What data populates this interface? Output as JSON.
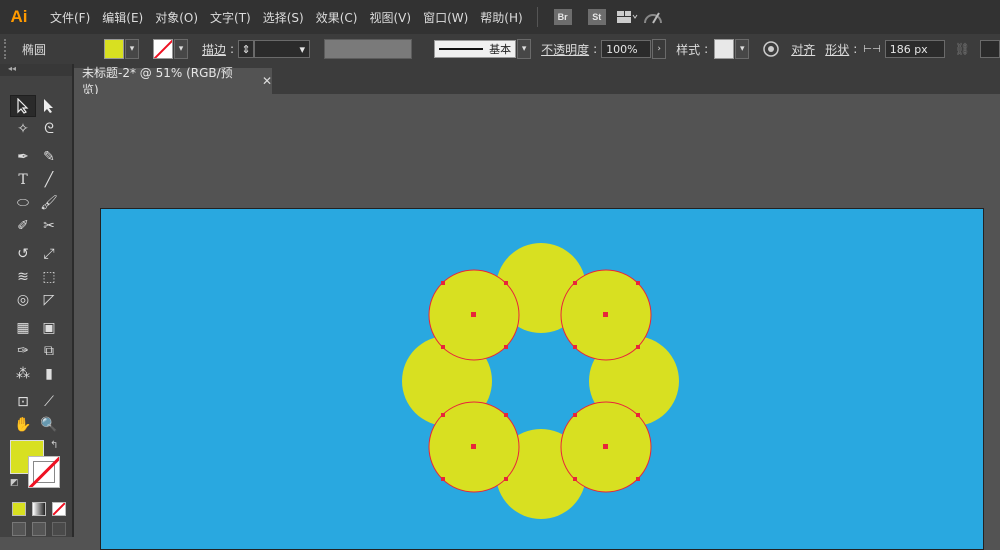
{
  "app": {
    "logo": "Ai",
    "menu": [
      "文件(F)",
      "编辑(E)",
      "对象(O)",
      "文字(T)",
      "选择(S)",
      "效果(C)",
      "视图(V)",
      "窗口(W)",
      "帮助(H)"
    ],
    "bridge_label": "Br",
    "stock_label": "St"
  },
  "control": {
    "object_type": "椭圆",
    "stroke_label": "描边",
    "profile_label": "基本",
    "opacity_label": "不透明度",
    "opacity_value": "100%",
    "style_label": "样式",
    "align_label": "对齐",
    "shape_label": "形状",
    "width_value": "186 px"
  },
  "document": {
    "tab_title": "未标题-2* @ 51% (RGB/预览)",
    "close_glyph": "✕"
  },
  "colors": {
    "fill": "#d8e021",
    "stroke": "#e8253a",
    "artboard": "#29a8e0"
  },
  "tools": [
    [
      "selection-tool",
      "direct-selection-tool"
    ],
    [
      "magic-wand-tool",
      "lasso-tool"
    ],
    [
      "pen-tool",
      "curvature-tool"
    ],
    [
      "type-tool",
      "line-segment-tool"
    ],
    [
      "ellipse-tool",
      "paintbrush-tool"
    ],
    [
      "shaper-tool",
      "scissors-tool"
    ],
    [
      "rotate-tool",
      "scale-tool"
    ],
    [
      "warp-tool",
      "free-transform-tool"
    ],
    [
      "shape-builder-tool",
      "perspective-grid-tool"
    ],
    [
      "mesh-tool",
      "gradient-tool"
    ],
    [
      "eyedropper-tool",
      "blend-tool"
    ],
    [
      "symbol-sprayer-tool",
      "column-graph-tool"
    ],
    [
      "artboard-tool",
      "slice-tool"
    ],
    [
      "hand-tool",
      "zoom-tool"
    ]
  ]
}
